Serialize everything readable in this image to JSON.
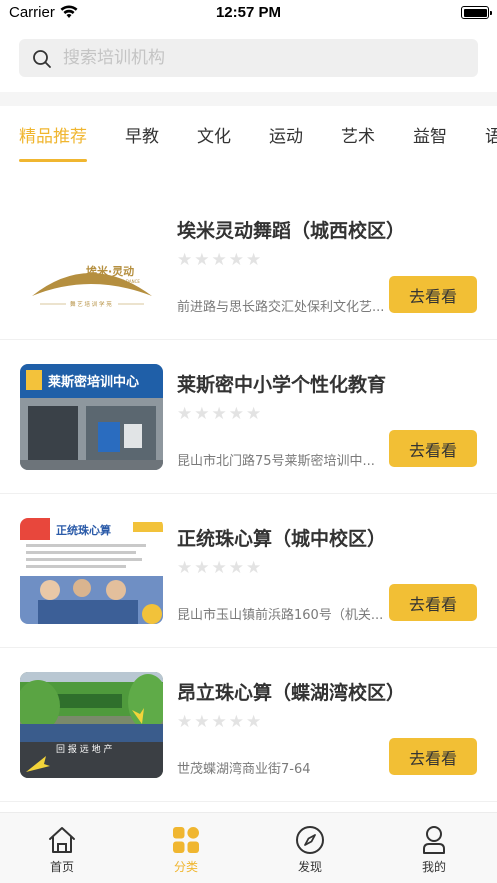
{
  "status_bar": {
    "carrier": "Carrier",
    "time": "12:57 PM"
  },
  "search": {
    "placeholder": "搜索培训机构"
  },
  "tabs": [
    {
      "label": "精品推荐",
      "active": true
    },
    {
      "label": "早教"
    },
    {
      "label": "文化"
    },
    {
      "label": "运动"
    },
    {
      "label": "艺术"
    },
    {
      "label": "益智"
    },
    {
      "label": "语"
    }
  ],
  "colors": {
    "accent": "#f0b630",
    "button": "#f2bf35",
    "star_empty": "#e3e3e3"
  },
  "institutions": [
    {
      "name": "埃米灵动舞蹈（城西校区）",
      "rating": 0,
      "stars": "★★★★★",
      "address": "前进路与思长路交汇处保利文化艺...",
      "button": "去看看",
      "logo_text": "埃米·灵动",
      "logo_sub": "JI MI LING DONG DANCE",
      "logo_tag": "舞 艺 培 训 学 苑"
    },
    {
      "name": "莱斯密中小学个性化教育",
      "rating": 0,
      "stars": "★★★★★",
      "address": "昆山市北门路75号莱斯密培训中...",
      "button": "去看看",
      "sign_text": "莱斯密培训中心"
    },
    {
      "name": "正统珠心算（城中校区）",
      "rating": 0,
      "stars": "★★★★★",
      "address": "昆山市玉山镇前浜路160号（机关...",
      "button": "去看看",
      "banner_text": "正统珠心算"
    },
    {
      "name": "昂立珠心算（蝶湖湾校区）",
      "rating": 0,
      "stars": "★★★★★",
      "address": "世茂蝶湖湾商业街7-64",
      "button": "去看看",
      "sign_text": "回 报 远 地 产"
    }
  ],
  "tabbar": [
    {
      "label": "首页",
      "icon": "home-icon"
    },
    {
      "label": "分类",
      "icon": "category-icon",
      "active": true
    },
    {
      "label": "发现",
      "icon": "compass-icon"
    },
    {
      "label": "我的",
      "icon": "profile-icon"
    }
  ]
}
